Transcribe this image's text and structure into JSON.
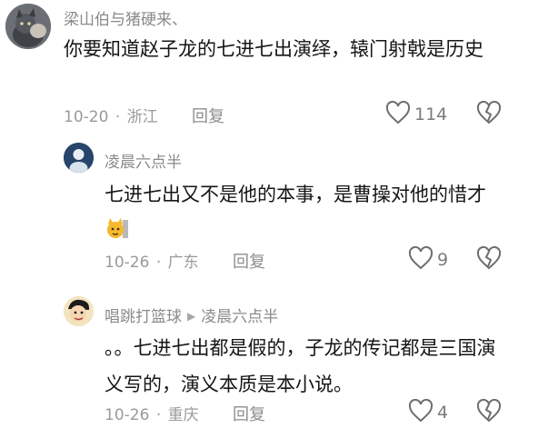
{
  "comments": [
    {
      "username": "梁山伯与猪硬来、",
      "text": "你要知道赵子龙的七进七出演绎，辕门射戟是历史",
      "date": "10-20",
      "location": "浙江",
      "reply_label": "回复",
      "likes": "114"
    },
    {
      "username": "凌晨六点半",
      "text": "七进七出又不是他的本事，是曹操对他的惜才",
      "date": "10-26",
      "location": "广东",
      "reply_label": "回复",
      "likes": "9"
    },
    {
      "username": "唱跳打篮球",
      "reply_to": "凌晨六点半",
      "text": "。。七进七出都是假的，子龙的传记都是三国演义写的，演义本质是本小说。",
      "date": "10-26",
      "location": "重庆",
      "reply_label": "回复",
      "likes": "4"
    }
  ],
  "separator": "·",
  "colors": {
    "text": "#161616",
    "meta": "#9a9a9a",
    "username": "#8a8a8a",
    "icon": "#6e6e6e"
  }
}
